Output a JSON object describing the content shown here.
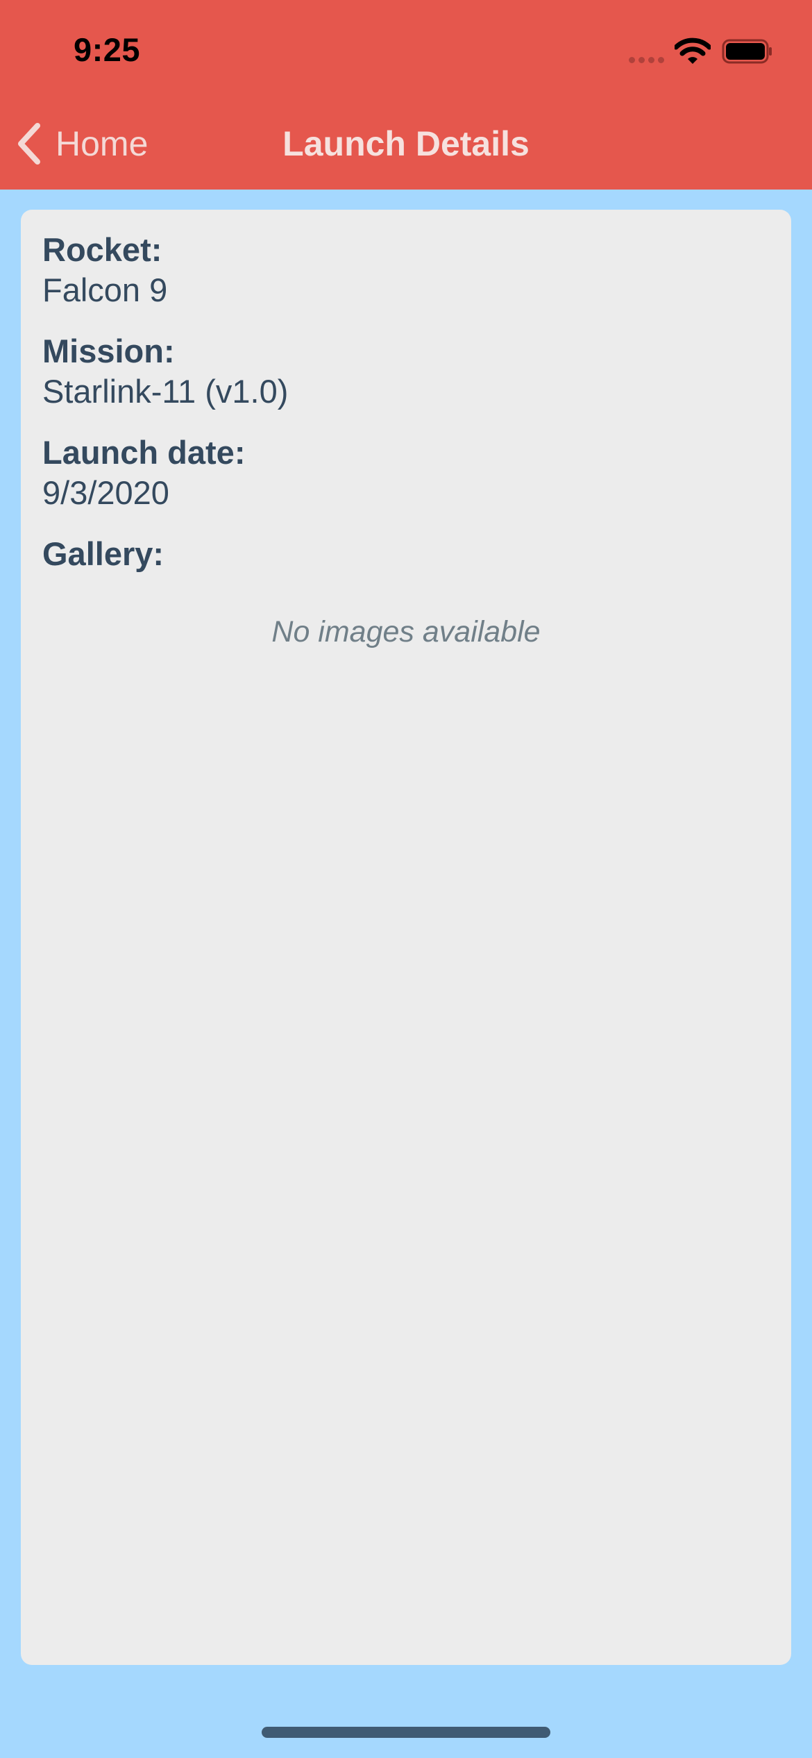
{
  "status_bar": {
    "time": "9:25"
  },
  "nav": {
    "back_label": "Home",
    "title": "Launch Details"
  },
  "details": {
    "rocket_label": "Rocket:",
    "rocket_value": "Falcon 9",
    "mission_label": "Mission:",
    "mission_value": "Starlink-11 (v1.0)",
    "launch_date_label": "Launch date:",
    "launch_date_value": "9/3/2020",
    "gallery_label": "Gallery:",
    "gallery_empty_text": "No images available"
  },
  "colors": {
    "header_bg": "#e5574d",
    "page_bg": "#a5d8fe",
    "card_bg": "#ececec",
    "text": "#34495e"
  }
}
